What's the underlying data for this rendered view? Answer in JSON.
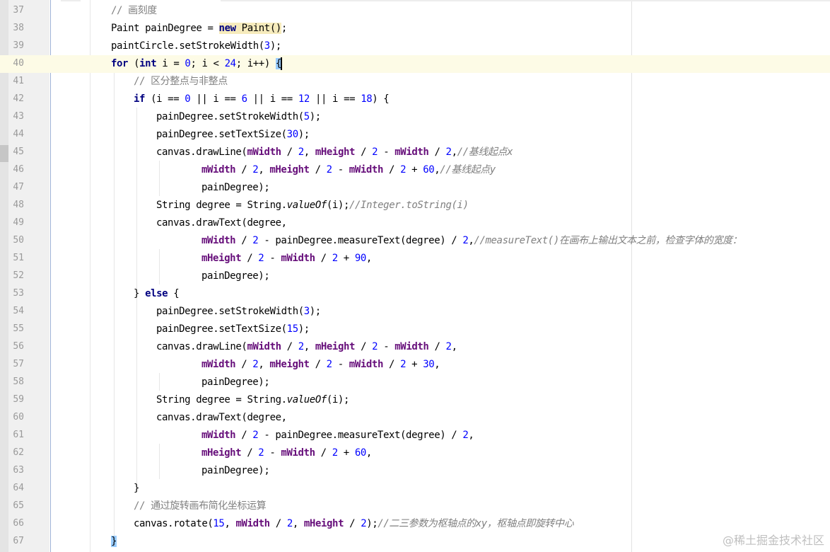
{
  "editor": {
    "current_line": 40,
    "lines": [
      {
        "n": 37,
        "indent": 3,
        "tokens": [
          {
            "t": "// 画刻度",
            "c": "cm"
          }
        ]
      },
      {
        "n": 38,
        "indent": 3,
        "tokens": [
          {
            "t": "Paint painDegree = "
          },
          {
            "t": "new",
            "c": "kw hl"
          },
          {
            "t": " Paint()",
            "c": "hl"
          },
          {
            "t": ";"
          }
        ]
      },
      {
        "n": 39,
        "indent": 3,
        "tokens": [
          {
            "t": "paintCircle.setStrokeWidth("
          },
          {
            "t": "3",
            "c": "num"
          },
          {
            "t": ");"
          }
        ]
      },
      {
        "n": 40,
        "indent": 3,
        "tokens": [
          {
            "t": "for",
            "c": "kw"
          },
          {
            "t": " ("
          },
          {
            "t": "int",
            "c": "kw"
          },
          {
            "t": " i = "
          },
          {
            "t": "0",
            "c": "num"
          },
          {
            "t": "; i < "
          },
          {
            "t": "24",
            "c": "num"
          },
          {
            "t": "; i++) "
          },
          {
            "t": "{",
            "c": "brace-hl"
          }
        ]
      },
      {
        "n": 41,
        "indent": 4,
        "tokens": [
          {
            "t": "// 区分整点与非整点",
            "c": "cm"
          }
        ]
      },
      {
        "n": 42,
        "indent": 4,
        "tokens": [
          {
            "t": "if",
            "c": "kw"
          },
          {
            "t": " (i == "
          },
          {
            "t": "0",
            "c": "num"
          },
          {
            "t": " || i == "
          },
          {
            "t": "6",
            "c": "num"
          },
          {
            "t": " || i == "
          },
          {
            "t": "12",
            "c": "num"
          },
          {
            "t": " || i == "
          },
          {
            "t": "18",
            "c": "num"
          },
          {
            "t": ") {"
          }
        ]
      },
      {
        "n": 43,
        "indent": 5,
        "tokens": [
          {
            "t": "painDegree.setStrokeWidth("
          },
          {
            "t": "5",
            "c": "num"
          },
          {
            "t": ");"
          }
        ]
      },
      {
        "n": 44,
        "indent": 5,
        "tokens": [
          {
            "t": "painDegree.setTextSize("
          },
          {
            "t": "30",
            "c": "num"
          },
          {
            "t": ");"
          }
        ]
      },
      {
        "n": 45,
        "indent": 5,
        "tokens": [
          {
            "t": "canvas.drawLine("
          },
          {
            "t": "mWidth",
            "c": "fld"
          },
          {
            "t": " / "
          },
          {
            "t": "2",
            "c": "num"
          },
          {
            "t": ", "
          },
          {
            "t": "mHeight",
            "c": "fld"
          },
          {
            "t": " / "
          },
          {
            "t": "2",
            "c": "num"
          },
          {
            "t": " - "
          },
          {
            "t": "mWidth",
            "c": "fld"
          },
          {
            "t": " / "
          },
          {
            "t": "2",
            "c": "num"
          },
          {
            "t": ","
          },
          {
            "t": "//基线起点x",
            "c": "cmi"
          }
        ]
      },
      {
        "n": 46,
        "indent": 7,
        "tokens": [
          {
            "t": "mWidth",
            "c": "fld"
          },
          {
            "t": " / "
          },
          {
            "t": "2",
            "c": "num"
          },
          {
            "t": ", "
          },
          {
            "t": "mHeight",
            "c": "fld"
          },
          {
            "t": " / "
          },
          {
            "t": "2",
            "c": "num"
          },
          {
            "t": " - "
          },
          {
            "t": "mWidth",
            "c": "fld"
          },
          {
            "t": " / "
          },
          {
            "t": "2",
            "c": "num"
          },
          {
            "t": " + "
          },
          {
            "t": "60",
            "c": "num"
          },
          {
            "t": ","
          },
          {
            "t": "//基线起点y",
            "c": "cmi"
          }
        ]
      },
      {
        "n": 47,
        "indent": 7,
        "tokens": [
          {
            "t": "painDegree);"
          }
        ]
      },
      {
        "n": 48,
        "indent": 5,
        "tokens": [
          {
            "t": "String degree = String."
          },
          {
            "t": "valueOf",
            "c": "st"
          },
          {
            "t": "(i);"
          },
          {
            "t": "//Integer.toString(i)",
            "c": "cmi"
          }
        ]
      },
      {
        "n": 49,
        "indent": 5,
        "tokens": [
          {
            "t": "canvas.drawText(degree,"
          }
        ]
      },
      {
        "n": 50,
        "indent": 7,
        "tokens": [
          {
            "t": "mWidth",
            "c": "fld"
          },
          {
            "t": " / "
          },
          {
            "t": "2",
            "c": "num"
          },
          {
            "t": " - painDegree.measureText(degree) / "
          },
          {
            "t": "2",
            "c": "num"
          },
          {
            "t": ","
          },
          {
            "t": "//measureText()在画布上输出文本之前，检查字体的宽度：",
            "c": "cmi"
          }
        ]
      },
      {
        "n": 51,
        "indent": 7,
        "tokens": [
          {
            "t": "mHeight",
            "c": "fld"
          },
          {
            "t": " / "
          },
          {
            "t": "2",
            "c": "num"
          },
          {
            "t": " - "
          },
          {
            "t": "mWidth",
            "c": "fld"
          },
          {
            "t": " / "
          },
          {
            "t": "2",
            "c": "num"
          },
          {
            "t": " + "
          },
          {
            "t": "90",
            "c": "num"
          },
          {
            "t": ","
          }
        ]
      },
      {
        "n": 52,
        "indent": 7,
        "tokens": [
          {
            "t": "painDegree);"
          }
        ]
      },
      {
        "n": 53,
        "indent": 4,
        "tokens": [
          {
            "t": "} "
          },
          {
            "t": "else",
            "c": "kw"
          },
          {
            "t": " {"
          }
        ]
      },
      {
        "n": 54,
        "indent": 5,
        "tokens": [
          {
            "t": "painDegree.setStrokeWidth("
          },
          {
            "t": "3",
            "c": "num"
          },
          {
            "t": ");"
          }
        ]
      },
      {
        "n": 55,
        "indent": 5,
        "tokens": [
          {
            "t": "painDegree.setTextSize("
          },
          {
            "t": "15",
            "c": "num"
          },
          {
            "t": ");"
          }
        ]
      },
      {
        "n": 56,
        "indent": 5,
        "tokens": [
          {
            "t": "canvas.drawLine("
          },
          {
            "t": "mWidth",
            "c": "fld"
          },
          {
            "t": " / "
          },
          {
            "t": "2",
            "c": "num"
          },
          {
            "t": ", "
          },
          {
            "t": "mHeight",
            "c": "fld"
          },
          {
            "t": " / "
          },
          {
            "t": "2",
            "c": "num"
          },
          {
            "t": " - "
          },
          {
            "t": "mWidth",
            "c": "fld"
          },
          {
            "t": " / "
          },
          {
            "t": "2",
            "c": "num"
          },
          {
            "t": ","
          }
        ]
      },
      {
        "n": 57,
        "indent": 7,
        "tokens": [
          {
            "t": "mWidth",
            "c": "fld"
          },
          {
            "t": " / "
          },
          {
            "t": "2",
            "c": "num"
          },
          {
            "t": ", "
          },
          {
            "t": "mHeight",
            "c": "fld"
          },
          {
            "t": " / "
          },
          {
            "t": "2",
            "c": "num"
          },
          {
            "t": " - "
          },
          {
            "t": "mWidth",
            "c": "fld"
          },
          {
            "t": " / "
          },
          {
            "t": "2",
            "c": "num"
          },
          {
            "t": " + "
          },
          {
            "t": "30",
            "c": "num"
          },
          {
            "t": ","
          }
        ]
      },
      {
        "n": 58,
        "indent": 7,
        "tokens": [
          {
            "t": "painDegree);"
          }
        ]
      },
      {
        "n": 59,
        "indent": 5,
        "tokens": [
          {
            "t": "String degree = String."
          },
          {
            "t": "valueOf",
            "c": "st"
          },
          {
            "t": "(i);"
          }
        ]
      },
      {
        "n": 60,
        "indent": 5,
        "tokens": [
          {
            "t": "canvas.drawText(degree,"
          }
        ]
      },
      {
        "n": 61,
        "indent": 7,
        "tokens": [
          {
            "t": "mWidth",
            "c": "fld"
          },
          {
            "t": " / "
          },
          {
            "t": "2",
            "c": "num"
          },
          {
            "t": " - painDegree.measureText(degree) / "
          },
          {
            "t": "2",
            "c": "num"
          },
          {
            "t": ","
          }
        ]
      },
      {
        "n": 62,
        "indent": 7,
        "tokens": [
          {
            "t": "mHeight",
            "c": "fld"
          },
          {
            "t": " / "
          },
          {
            "t": "2",
            "c": "num"
          },
          {
            "t": " - "
          },
          {
            "t": "mWidth",
            "c": "fld"
          },
          {
            "t": " / "
          },
          {
            "t": "2",
            "c": "num"
          },
          {
            "t": " + "
          },
          {
            "t": "60",
            "c": "num"
          },
          {
            "t": ","
          }
        ]
      },
      {
        "n": 63,
        "indent": 7,
        "tokens": [
          {
            "t": "painDegree);"
          }
        ]
      },
      {
        "n": 64,
        "indent": 4,
        "tokens": [
          {
            "t": "}"
          }
        ]
      },
      {
        "n": 65,
        "indent": 4,
        "tokens": [
          {
            "t": "// 通过旋转画布简化坐标运算",
            "c": "cm"
          }
        ]
      },
      {
        "n": 66,
        "indent": 4,
        "tokens": [
          {
            "t": "canvas.rotate("
          },
          {
            "t": "15",
            "c": "num"
          },
          {
            "t": ", "
          },
          {
            "t": "mWidth",
            "c": "fld"
          },
          {
            "t": " / "
          },
          {
            "t": "2",
            "c": "num"
          },
          {
            "t": ", "
          },
          {
            "t": "mHeight",
            "c": "fld"
          },
          {
            "t": " / "
          },
          {
            "t": "2",
            "c": "num"
          },
          {
            "t": ");"
          },
          {
            "t": "//二三参数为枢轴点的xy，枢轴点即旋转中心",
            "c": "cmi"
          }
        ]
      },
      {
        "n": 67,
        "indent": 3,
        "tokens": [
          {
            "t": "}",
            "c": "brace-hl"
          }
        ]
      }
    ]
  },
  "watermark": "@稀土掘金技术社区",
  "colors": {
    "keyword": "#000080",
    "field": "#660e7a",
    "number": "#0000ff",
    "comment": "#808080",
    "current_line": "#fdfbe6",
    "brace_match": "#99ccff",
    "usage_highlight": "#f6ebbc"
  }
}
